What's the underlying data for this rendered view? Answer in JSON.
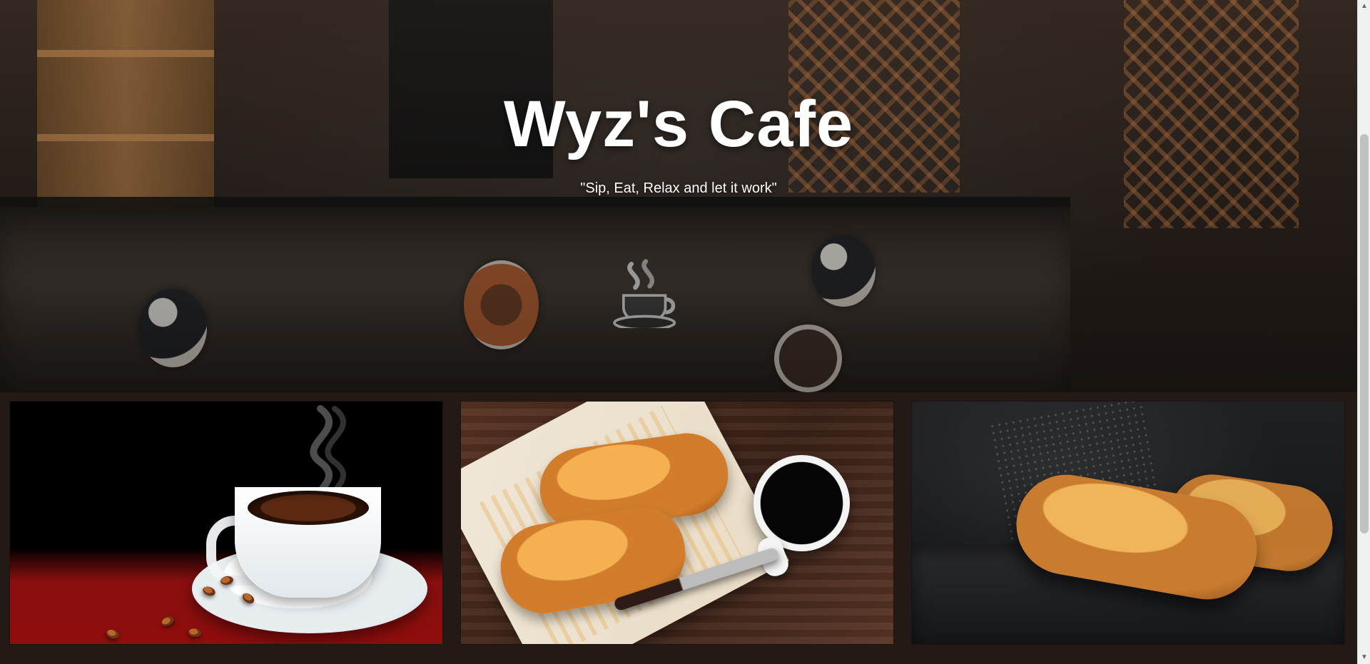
{
  "hero": {
    "title": "Wyz's Cafe",
    "tagline": "\"Sip, Eat, Relax and let it work\""
  },
  "gallery": {
    "items": [
      {
        "name": "coffee-cup-image"
      },
      {
        "name": "croissants-coffee-image"
      },
      {
        "name": "croissants-slate-image"
      }
    ]
  },
  "icons": {
    "scroll_up": "scroll-up-icon",
    "scroll_down": "scroll-down-icon"
  }
}
